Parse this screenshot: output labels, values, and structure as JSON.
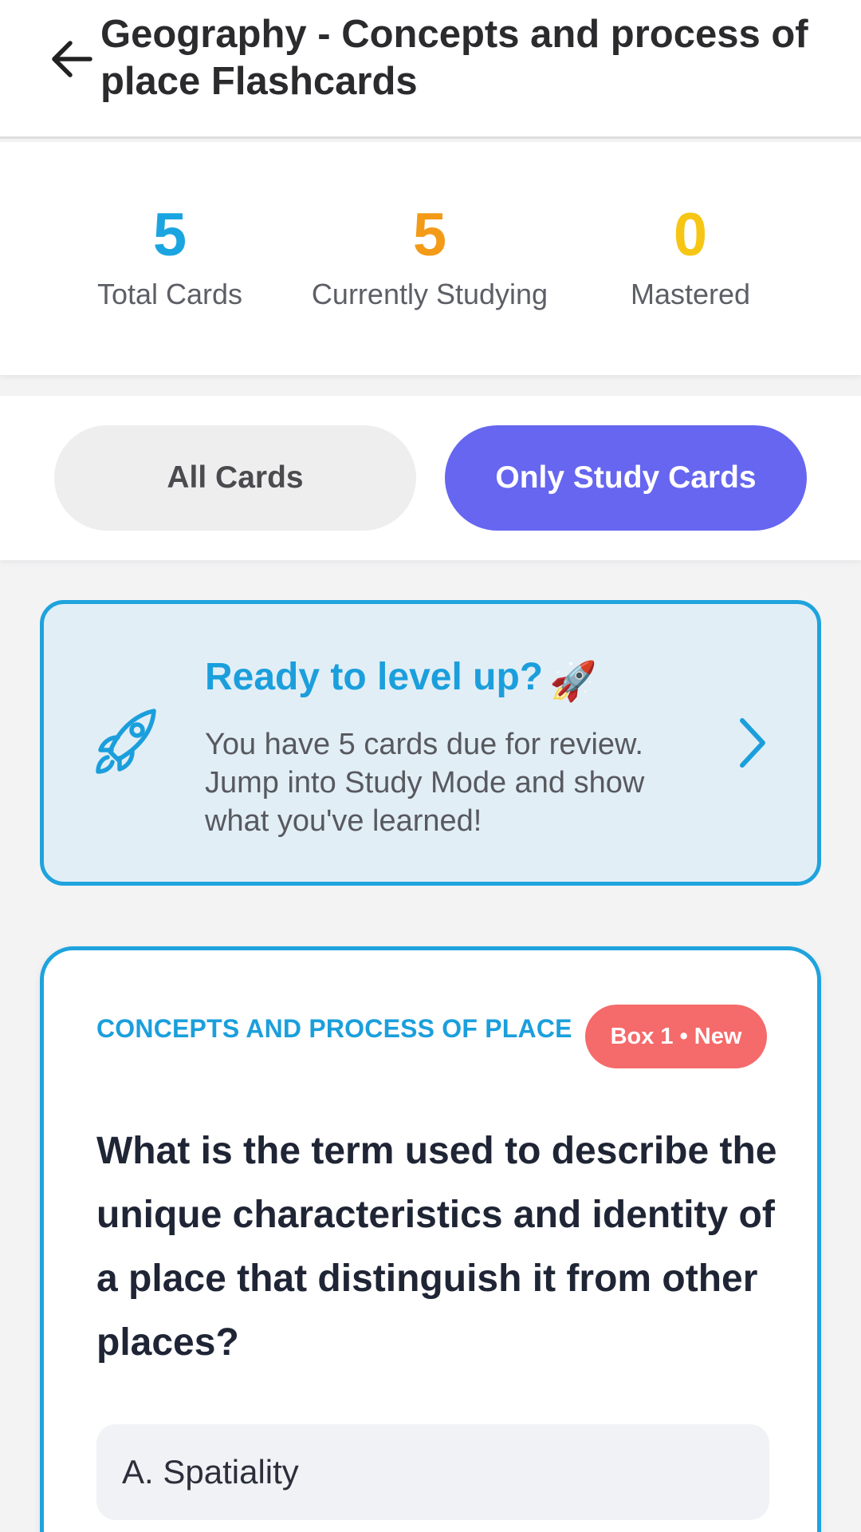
{
  "header": {
    "title": "Geography - Concepts and process of place Flashcards",
    "back_icon": "arrow-left-icon"
  },
  "stats": [
    {
      "value": "5",
      "label": "Total Cards",
      "color": "#1ba5e0"
    },
    {
      "value": "5",
      "label": "Currently Studying",
      "color": "#f39a17"
    },
    {
      "value": "0",
      "label": "Mastered",
      "color": "#f7c614"
    }
  ],
  "filter": {
    "all_label": "All Cards",
    "study_label": "Only Study Cards",
    "selected": "Only Study Cards",
    "accent": "#6666f0"
  },
  "banner": {
    "title": "Ready to level up?",
    "emoji": "🚀",
    "text": "You have 5 cards due for review. Jump into Study Mode and show what you've learned!",
    "icon": "rocket-icon",
    "chevron_icon": "chevron-right-icon",
    "accent": "#1fa3dd"
  },
  "card": {
    "category": "CONCEPTS AND PROCESS OF PLACE",
    "badge": "Box 1 • New",
    "badge_color": "#f56a6a",
    "question": "What is the term used to describe the unique characteristics and identity of a place that distinguish it from other places?",
    "options": [
      "A. Spatiality"
    ]
  }
}
